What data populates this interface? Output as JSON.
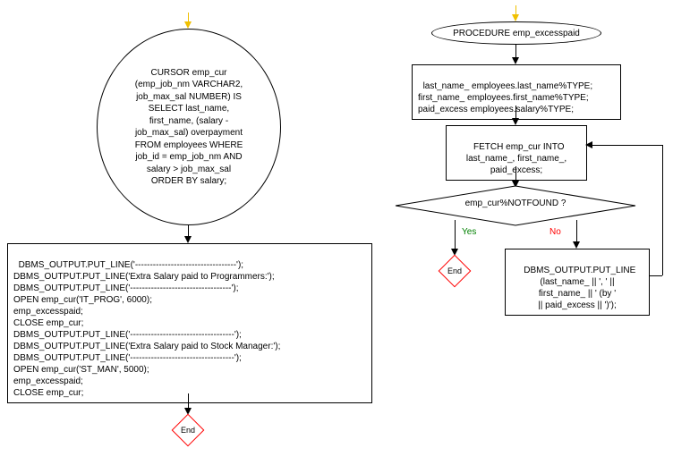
{
  "left": {
    "cursor_text": "CURSOR emp_cur\n(emp_job_nm VARCHAR2,\njob_max_sal NUMBER) IS\nSELECT last_name,\nfirst_name, (salary -\njob_max_sal) overpayment\nFROM employees WHERE\njob_id = emp_job_nm AND\nsalary > job_max_sal\nORDER BY salary;",
    "body_text": "DBMS_OUTPUT.PUT_LINE('----------------------------------');\nDBMS_OUTPUT.PUT_LINE('Extra Salary paid to Programmers:');\nDBMS_OUTPUT.PUT_LINE('----------------------------------');\nOPEN emp_cur('IT_PROG', 6000);\nemp_excesspaid;\nCLOSE emp_cur;\nDBMS_OUTPUT.PUT_LINE('-----------------------------------');\nDBMS_OUTPUT.PUT_LINE('Extra Salary paid to Stock Manager:');\nDBMS_OUTPUT.PUT_LINE('-----------------------------------');\nOPEN emp_cur('ST_MAN', 5000);\nemp_excesspaid;\nCLOSE emp_cur;",
    "end_label": "End"
  },
  "right": {
    "proc_text": "PROCEDURE emp_excesspaid",
    "decl_text": "last_name_ employees.last_name%TYPE;\nfirst_name_ employees.first_name%TYPE;\npaid_excess employees.salary%TYPE;",
    "fetch_text": "FETCH emp_cur INTO\nlast_name_, first_name_,\npaid_excess;",
    "decision_text": "emp_cur%NOTFOUND ?",
    "yes_label": "Yes",
    "no_label": "No",
    "putline_text": "DBMS_OUTPUT.PUT_LINE\n(last_name_ || ', ' ||\nfirst_name_ || ' (by '\n|| paid_excess || ')');",
    "end_label": "End"
  }
}
